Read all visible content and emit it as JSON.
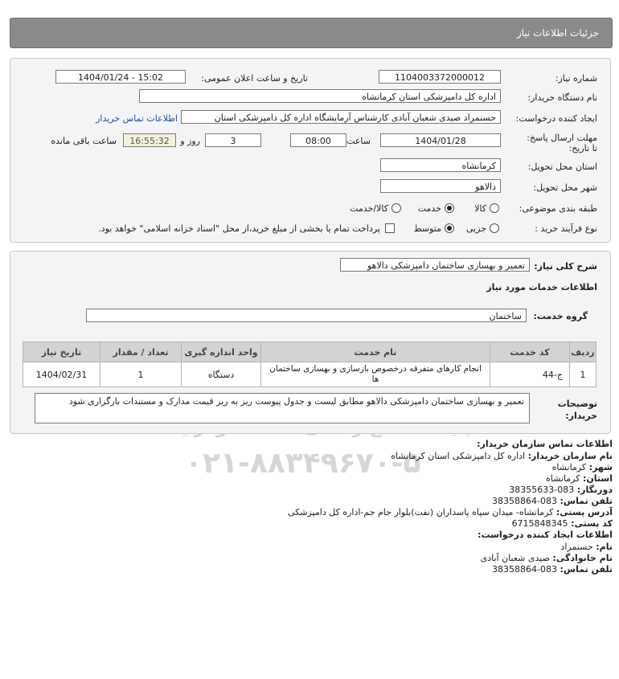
{
  "header": {
    "title": "جزئیات اطلاعات نیاز"
  },
  "details": {
    "need_number_label": "شماره نیاز:",
    "need_number": "1104003372000012",
    "announce_label": "تاریخ و ساعت اعلان عمومی:",
    "announce_value": "1404/01/24 - 15:02",
    "buyer_label": "نام دستگاه خریدار:",
    "buyer_value": "اداره کل دامپزشکی استان کرمانشاه",
    "creator_label": "ایجاد کننده درخواست:",
    "creator_value": "حسنمراد صیدی شعبان آبادی کارشناس آزمایشگاه اداره کل دامپزشکی استان",
    "contact_link": "اطلاعات تماس خریدار",
    "deadline_label": "مهلت ارسال پاسخ: تا تاریخ:",
    "deadline_date": "1404/01/28",
    "time_label": "ساعت",
    "deadline_time": "08:00",
    "days_value": "3",
    "days_label": "روز و",
    "remaining_time": "16:55:32",
    "remaining_label": "ساعت باقی مانده",
    "province_label": "استان محل تحویل:",
    "province_value": "کرمانشاه",
    "city_label": "شهر محل تحویل:",
    "city_value": "دالاهو",
    "category_label": "طبقه بندی موضوعی:",
    "category_options": [
      "کالا",
      "خدمت",
      "کالا/خدمت"
    ],
    "category_selected": "خدمت",
    "process_label": "نوع فرآیند خرید :",
    "process_options": [
      "جزیی",
      "متوسط"
    ],
    "process_selected": "متوسط",
    "treasury_text": "پرداخت تمام یا بخشی از مبلغ خرید،از محل \"اسناد خزانه اسلامی\" خواهد بود."
  },
  "summary": {
    "label": "شرح کلی نیاز:",
    "value": "تعمیر و بهسازی ساختمان دامپزشکی دالاهو",
    "services_title": "اطلاعات خدمات مورد نیاز",
    "group_label": "گروه خدمت:",
    "group_value": "ساختمان"
  },
  "table": {
    "headers": [
      "ردیف",
      "کد خدمت",
      "نام خدمت",
      "واحد اندازه گیری",
      "تعداد / مقدار",
      "تاریخ نیاز"
    ],
    "rows": [
      [
        "1",
        "ج-44",
        "انجام کارهای متفرقه درخصوص بازسازی و بهسازی ساختمان ها",
        "دستگاه",
        "1",
        "1404/02/31"
      ]
    ]
  },
  "buyer_notes": {
    "label": "توضیحات خریدار:",
    "value": "تعمیر و بهسازی ساختمان دامپزشکی دالاهو مطابق لیست و جدول پیوست ریز به ریز قیمت مدارک و مستندات بارگزاری شود"
  },
  "contact": {
    "org_title": "اطلاعات تماس سازمان خریدار:",
    "org_name_label": "نام سازمان خریدار:",
    "org_name": "اداره کل دامپزشکی استان کرمانشاه",
    "city_label": "شهر:",
    "city": "کرمانشاه",
    "province_label": "استان:",
    "province": "کرمانشاه",
    "fax_label": "دورنگار:",
    "fax": "083-38355633",
    "phone_label": "تلفن تماس:",
    "phone": "083-38358864",
    "address_label": "آدرس پستی:",
    "address": "کرمانشاه- میدان سپاه پاسداران (نفت)بلوار جام جم-اداره کل دامپزشکی",
    "postal_label": "کد پستی:",
    "postal": "6715848345",
    "creator_title": "اطلاعات ایجاد کننده درخواست:",
    "first_name_label": "نام:",
    "first_name": "حسنمراد",
    "last_name_label": "نام خانوادگی:",
    "last_name": "صیدی شعبان آبادی",
    "creator_phone_label": "تلفن تماس:",
    "creator_phone": "083-38358864"
  },
  "watermark": {
    "line1": "پایگاه اطلاع رسانی مناقصه ومزایده",
    "line2": "۰۲۱-۸۸۳۴۹۶۷۰-۵",
    "brand": "ParsNamad"
  }
}
